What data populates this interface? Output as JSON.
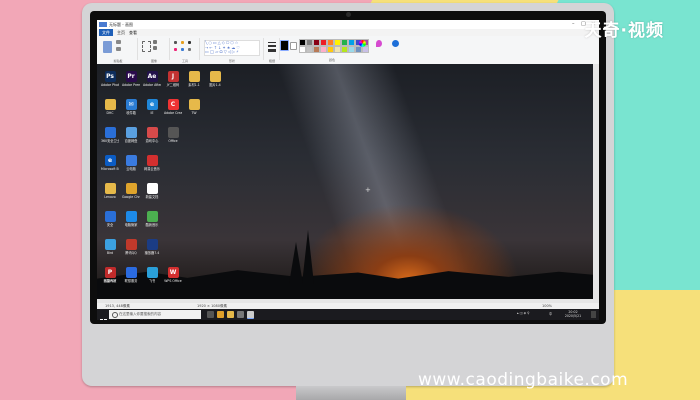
{
  "watermark_top": "天奇·视频",
  "watermark_bottom": "www.caodingbaike.com",
  "paint": {
    "title": "无标题 - 画图",
    "menu_tabs": [
      "文件",
      "主页",
      "查看"
    ],
    "ribbon_groups": [
      "剪贴板",
      "图像",
      "工具",
      "形状",
      "粗细",
      "颜色"
    ],
    "status": {
      "pos": "1913, 448像素",
      "size": "1920 × 1080像素",
      "zoom": "100%"
    }
  },
  "desktop_icons": [
    {
      "name": "ps",
      "label": "Adobe Photoshop CC 2019",
      "glyph": "Ps",
      "color": "#0e2d5c"
    },
    {
      "name": "pr",
      "label": "Adobe Premiere P...",
      "glyph": "Pr",
      "color": "#2a0a4c"
    },
    {
      "name": "ae",
      "label": "Adobe After Effects CC ...",
      "glyph": "Ae",
      "color": "#22124a"
    },
    {
      "name": "kuaijian",
      "label": "JY二维码",
      "glyph": "J",
      "color": "#c23232"
    },
    {
      "name": "folder1",
      "label": "素材1.1",
      "glyph": "",
      "color": "#e6b94a"
    },
    {
      "name": "folder2",
      "label": "图片1.4",
      "glyph": "",
      "color": "#e6b94a"
    },
    {
      "name": "folder3",
      "label": "DHC",
      "glyph": "",
      "color": "#e6b94a"
    },
    {
      "name": "mail",
      "label": "收件箱",
      "glyph": "✉",
      "color": "#2b7cd3"
    },
    {
      "name": "ie",
      "label": "IE",
      "glyph": "e",
      "color": "#1f86d8"
    },
    {
      "name": "creative",
      "label": "Adobe Creati...",
      "glyph": "C",
      "color": "#e33"
    },
    {
      "name": "folder4",
      "label": "TW",
      "glyph": "",
      "color": "#e6b94a"
    },
    {
      "name": "monitor",
      "label": "360安全卫士",
      "glyph": "",
      "color": "#2a6fd8"
    },
    {
      "name": "wheel",
      "label": "百度网盘",
      "glyph": "",
      "color": "#5aa0e0"
    },
    {
      "name": "gamepad",
      "label": "游戏中心",
      "glyph": "",
      "color": "#d64a4a"
    },
    {
      "name": "office",
      "label": "Office",
      "glyph": "",
      "color": "#555"
    },
    {
      "name": "edge",
      "label": "Microsoft Edge",
      "glyph": "e",
      "color": "#0b5cc4"
    },
    {
      "name": "netdisk",
      "label": "云电脑",
      "glyph": "",
      "color": "#3a7be0"
    },
    {
      "name": "netease",
      "label": "网易云音乐",
      "glyph": "",
      "color": "#d32f2f"
    },
    {
      "name": "folder5",
      "label": "Lenovo",
      "glyph": "",
      "color": "#e6b94a"
    },
    {
      "name": "chrome",
      "label": "Google Chrome",
      "glyph": "",
      "color": "#dfa42c"
    },
    {
      "name": "doc",
      "label": "新建文档",
      "glyph": "",
      "color": "#ffffff"
    },
    {
      "name": "shield",
      "label": "安全",
      "glyph": "",
      "color": "#2a6fd8"
    },
    {
      "name": "manager",
      "label": "电脑管家",
      "glyph": "",
      "color": "#1d8ae8"
    },
    {
      "name": "clover",
      "label": "酷我音乐",
      "glyph": "",
      "color": "#4caf50"
    },
    {
      "name": "bird",
      "label": "Bird",
      "glyph": "",
      "color": "#3ca0e0"
    },
    {
      "name": "people",
      "label": "腾讯QQ",
      "glyph": "",
      "color": "#c0392b"
    },
    {
      "name": "player",
      "label": "播放器7.4",
      "glyph": "",
      "color": "#1b3c84"
    },
    {
      "name": "netease2",
      "label": "网易有道",
      "glyph": "",
      "color": "#555"
    },
    {
      "name": "lenovo-app",
      "label": "联想服务",
      "glyph": "",
      "color": "#2b6be0"
    },
    {
      "name": "feishu",
      "label": "飞书",
      "glyph": "",
      "color": "#2a9fd8"
    },
    {
      "name": "wps",
      "label": "WPS Office",
      "glyph": "W",
      "color": "#d32f2f"
    },
    {
      "name": "pdf",
      "label": "迅捷PDF",
      "glyph": "P",
      "color": "#c02a2a"
    }
  ],
  "taskbar": {
    "search_placeholder": "在这里输入你要搜索的内容",
    "time": "20:02",
    "date": "2020/5/21",
    "lang": "中"
  }
}
